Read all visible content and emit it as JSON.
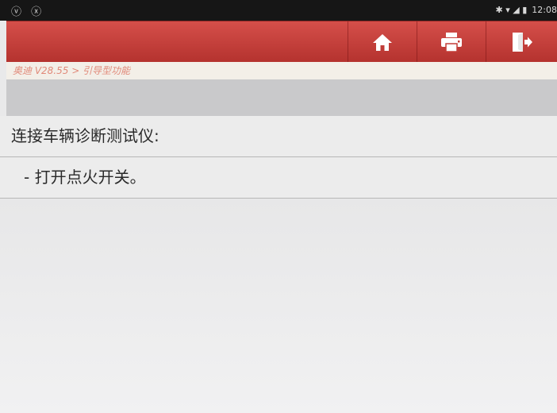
{
  "statusbar": {
    "left_icons": "ⓥ ⓧ",
    "right_icons": "✱ ▾ ◢ ▮",
    "time": "12:08"
  },
  "toolbar": {
    "home_icon": "home-icon",
    "print_icon": "printer-icon",
    "exit_icon": "exit-icon",
    "accent_color": "#c33d38"
  },
  "breadcrumb": {
    "text": "奥迪 V28.55 > 引导型功能"
  },
  "instruction": {
    "title": "连接车辆诊断测试仪:",
    "step": "- 打开点火开关。"
  }
}
